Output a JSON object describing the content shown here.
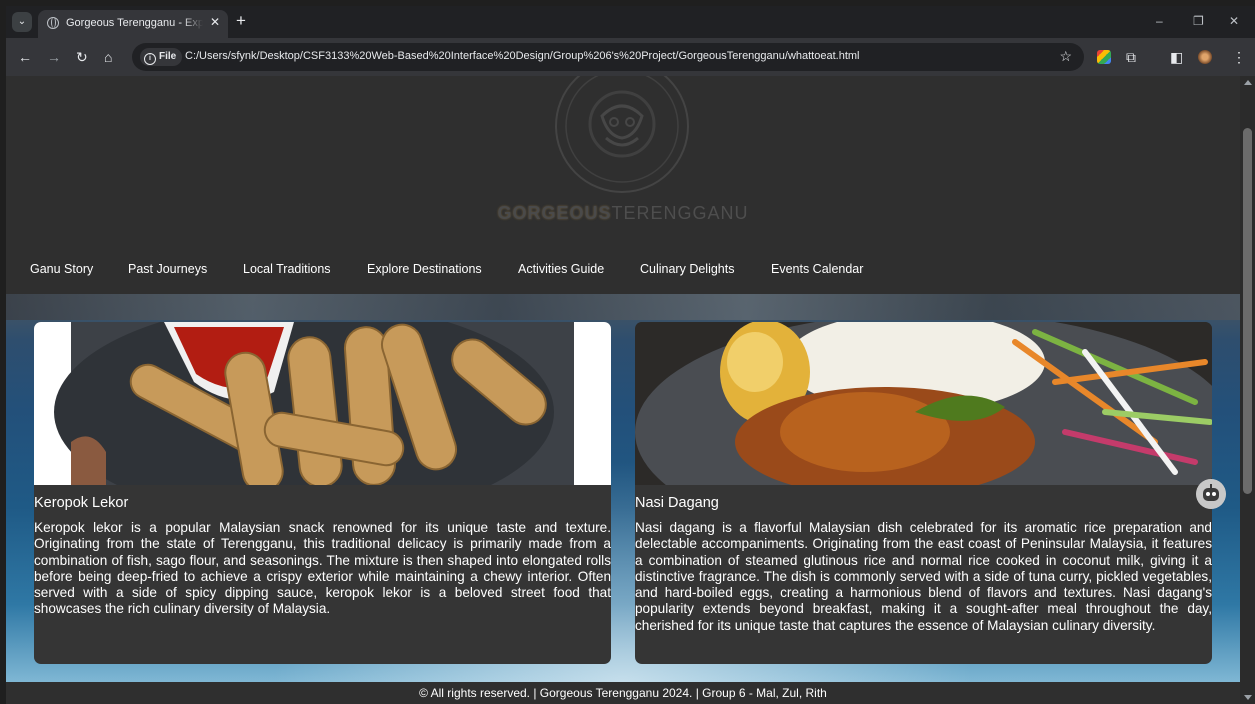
{
  "browser": {
    "tab_title": "Gorgeous Terengganu - Explore",
    "tab_close": "✕",
    "new_tab": "+",
    "url_chip": "File",
    "url": "C:/Users/sfynk/Desktop/CSF3133%20Web-Based%20Interface%20Design/Group%206's%20Project/GorgeousTerengganu/whattoeat.html",
    "window_controls": {
      "minimize": "–",
      "restore": "❐",
      "close": "✕"
    }
  },
  "site": {
    "brand_bold": "GORGEOUS",
    "brand_light": "TERENGGANU",
    "nav": [
      "Ganu Story",
      "Past Journeys",
      "Local Traditions",
      "Explore Destinations",
      "Activities Guide",
      "Culinary Delights",
      "Events Calendar"
    ]
  },
  "cards": [
    {
      "name": "Keropok Lekor",
      "description": "Keropok lekor is a popular Malaysian snack renowned for its unique taste and texture. Originating from the state of Terengganu, this traditional delicacy is primarily made from a combination of fish, sago flour, and seasonings. The mixture is then shaped into elongated rolls before being deep-fried to achieve a crispy exterior while maintaining a chewy interior. Often served with a side of spicy dipping sauce, keropok lekor is a beloved street food that showcases the rich culinary diversity of Malaysia."
    },
    {
      "name": "Nasi Dagang",
      "description": "Nasi dagang is a flavorful Malaysian dish celebrated for its aromatic rice preparation and delectable accompaniments. Originating from the east coast of Peninsular Malaysia, it features a combination of steamed glutinous rice and normal rice cooked in coconut milk, giving it a distinctive fragrance. The dish is commonly served with a side of tuna curry, pickled vegetables, and hard-boiled eggs, creating a harmonious blend of flavors and textures. Nasi dagang's popularity extends beyond breakfast, making it a sought-after meal throughout the day, cherished for its unique taste that captures the essence of Malaysian culinary diversity."
    }
  ],
  "footer": "© All rights reserved. | Gorgeous Terengganu 2024. | Group 6 - Mal, Zul, Rith"
}
